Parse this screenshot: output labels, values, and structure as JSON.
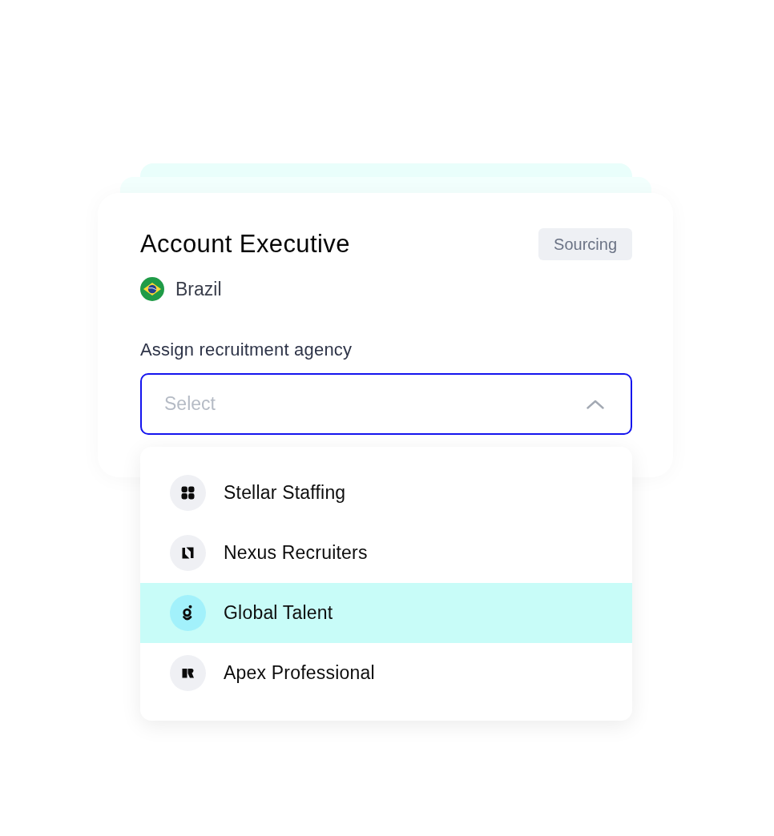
{
  "job": {
    "title": "Account Executive",
    "status": "Sourcing",
    "country": "Brazil"
  },
  "agency_select": {
    "label": "Assign recruitment agency",
    "placeholder": "Select",
    "expanded": true,
    "options": [
      {
        "name": "Stellar Staffing",
        "kind": "grid",
        "selected": false
      },
      {
        "name": "Nexus Recruiters",
        "kind": "zigzag",
        "selected": false
      },
      {
        "name": "Global Talent",
        "kind": "ring",
        "selected": true
      },
      {
        "name": "Apex Professional",
        "kind": "block",
        "selected": false
      }
    ]
  }
}
